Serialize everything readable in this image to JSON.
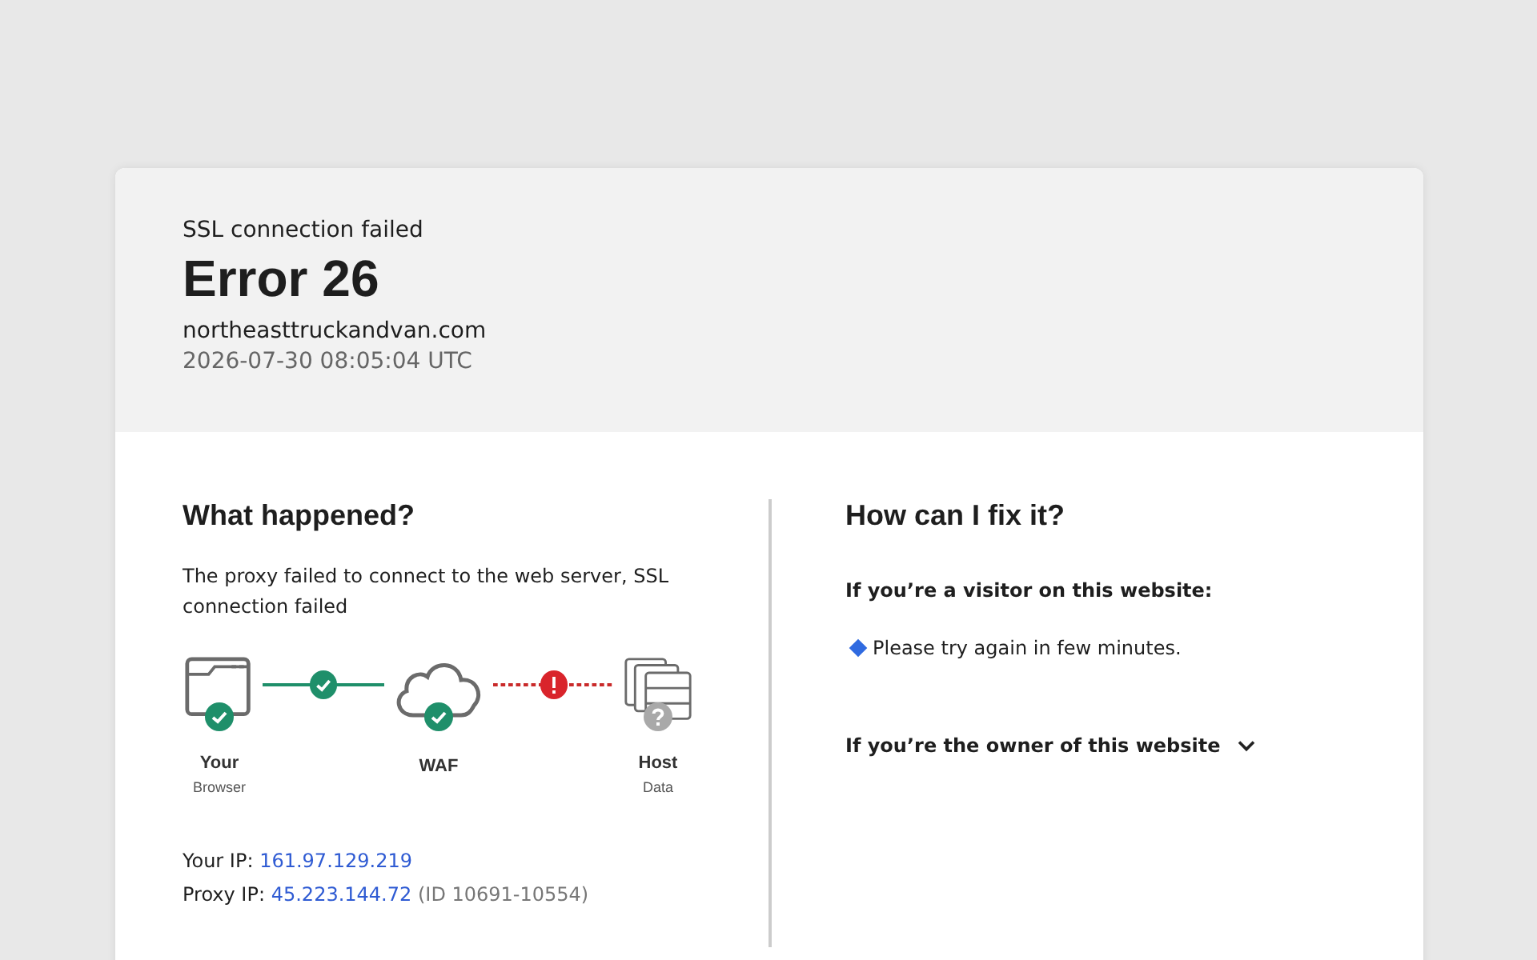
{
  "header": {
    "subtitle": "SSL connection failed",
    "title": "Error 26",
    "domain": "northeasttruckandvan.com",
    "timestamp": "2026-07-30 08:05:04 UTC"
  },
  "what_happened": {
    "heading": "What happened?",
    "text": "The proxy failed to connect to the web server, SSL connection failed",
    "nodes": [
      {
        "kind": "browser",
        "label": "Your",
        "sublabel": "Browser",
        "ok": true
      },
      {
        "kind": "cloud",
        "label": "WAF",
        "ok": true
      },
      {
        "kind": "server",
        "label": "Host",
        "sublabel": "Data",
        "ok": false
      }
    ],
    "links": [
      {
        "ok": true
      },
      {
        "ok": false
      }
    ],
    "your_ip": {
      "label": "Your IP:",
      "value": "161.97.129.219"
    },
    "proxy_ip": {
      "label": "Proxy IP:",
      "value": "45.223.144.72",
      "note": "(ID 10691-10554)"
    }
  },
  "fix": {
    "heading": "How can I fix it?",
    "visitor_heading": "If you’re a visitor on this website:",
    "visitor_items": [
      "Please try again in few minutes."
    ],
    "owner_heading": "If you’re the owner of this website",
    "owner_expanded": false
  }
}
